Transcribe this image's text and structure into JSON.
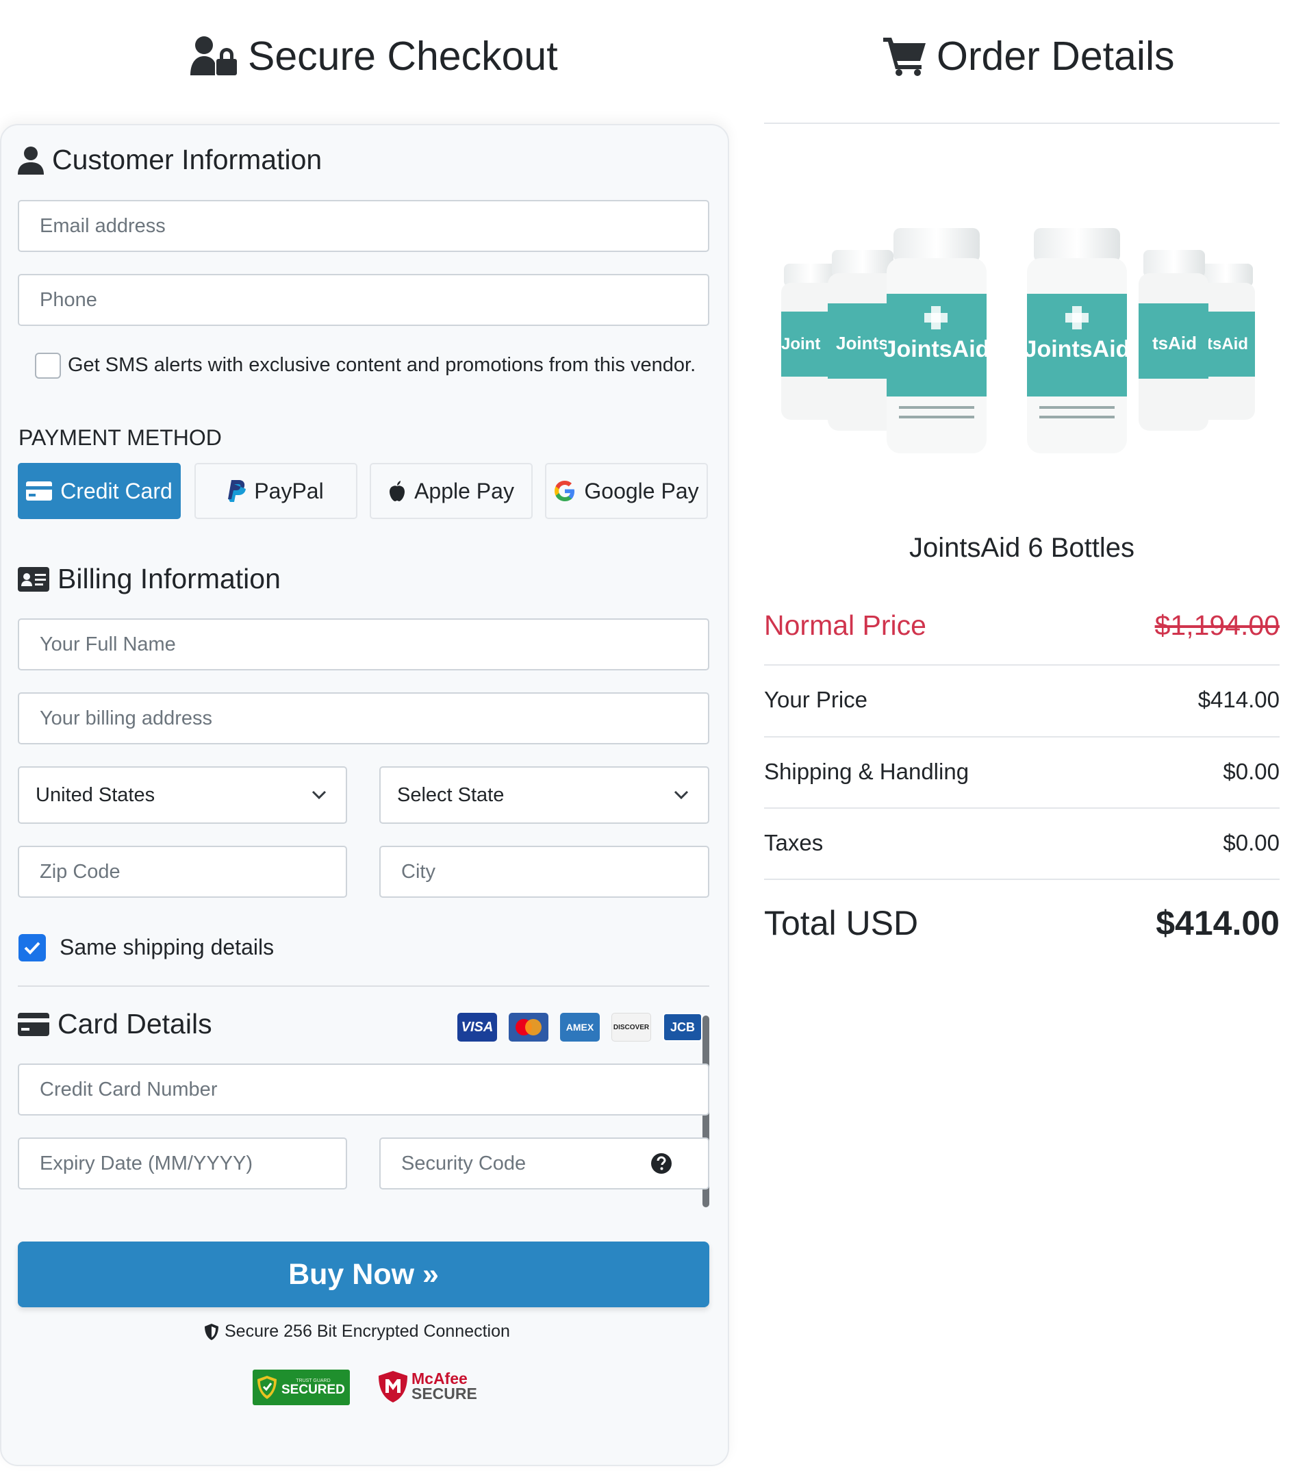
{
  "checkout_heading": "Secure Checkout",
  "order_heading": "Order Details",
  "customer": {
    "title": "Customer Information",
    "email_placeholder": "Email address",
    "phone_placeholder": "Phone",
    "sms_label": "Get SMS alerts with exclusive content and promotions from this vendor."
  },
  "payment": {
    "title": "PAYMENT METHOD",
    "methods": [
      "Credit Card",
      "PayPal",
      "Apple Pay",
      "Google Pay"
    ],
    "selected": "Credit Card"
  },
  "billing": {
    "title": "Billing Information",
    "name_placeholder": "Your Full Name",
    "address_placeholder": "Your billing address",
    "country_value": "United States",
    "state_value": "Select State",
    "zip_placeholder": "Zip Code",
    "city_placeholder": "City",
    "same_shipping_label": "Same shipping details",
    "same_shipping_checked": true
  },
  "card": {
    "title": "Card Details",
    "logos": [
      "VISA",
      "Mastercard",
      "AMEX",
      "DISCOVER",
      "JCB"
    ],
    "number_placeholder": "Credit Card Number",
    "expiry_placeholder": "Expiry Date (MM/YYYY)",
    "cvv_placeholder": "Security Code"
  },
  "buy_button": "Buy Now »",
  "secure_note": "Secure 256 Bit Encrypted Connection",
  "badges": {
    "trust_small": "TRUST GUARD",
    "trust_main": "SECURED",
    "mcafee_top": "McAfee",
    "mcafee_bottom": "SECURE"
  },
  "product": {
    "name": "JointsAid 6 Bottles",
    "bottle_label": "JointsAid"
  },
  "pricing": {
    "normal_label": "Normal Price",
    "normal_value": "$1,194.00",
    "your_label": "Your Price",
    "your_value": "$414.00",
    "shipping_label": "Shipping & Handling",
    "shipping_value": "$0.00",
    "taxes_label": "Taxes",
    "taxes_value": "$0.00",
    "total_label": "Total USD",
    "total_value": "$414.00"
  },
  "colors": {
    "primary": "#2a86c2",
    "normal_price_red": "#d0344d",
    "checkbox_blue": "#1a73e8",
    "bottle_teal": "#4bb3ad"
  }
}
